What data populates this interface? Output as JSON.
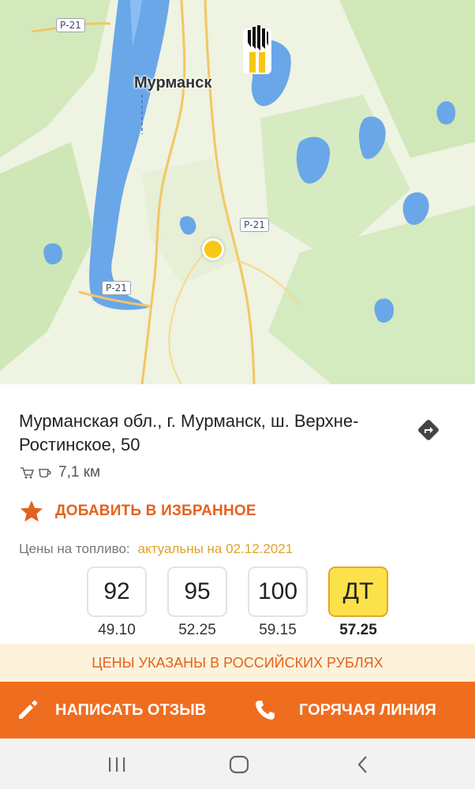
{
  "map": {
    "city_label": "Мурманск",
    "road_badges": [
      "Р-21",
      "Р-21",
      "Р-21"
    ]
  },
  "station": {
    "address": "Мурманская обл., г. Мурманск, ш. Верхне-Ростинское, 50",
    "distance": "7,1  км",
    "amenity_icons": [
      "cart-icon",
      "coffee-cup-icon"
    ]
  },
  "favorite": {
    "label": "ДОБАВИТЬ В ИЗБРАННОЕ"
  },
  "prices_header": {
    "label": "Цены на топливо:",
    "date_text": "актуальны на 02.12.2021"
  },
  "fuels": [
    {
      "grade": "92",
      "price": "49.10"
    },
    {
      "grade": "95",
      "price": "52.25"
    },
    {
      "grade": "100",
      "price": "59.15"
    },
    {
      "grade": "ДТ",
      "price": "57.25",
      "selected": true
    }
  ],
  "currency_note": "ЦЕНЫ УКАЗАНЫ В РОССИЙСКИХ РУБЛЯХ",
  "actions": {
    "review_label": "НАПИСАТЬ ОТЗЫВ",
    "hotline_label": "ГОРЯЧАЯ ЛИНИЯ"
  },
  "colors": {
    "accent": "#ef6d1e",
    "selected_fuel": "#fce24a",
    "date_highlight": "#e0a22a",
    "currency_bg": "#fdf3dc"
  }
}
